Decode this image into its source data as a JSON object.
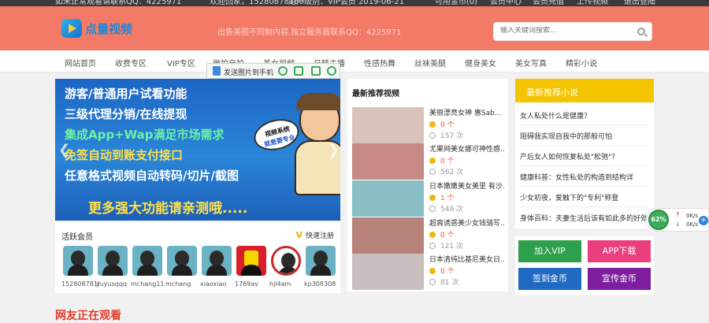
{
  "topbar": {
    "left": "如未正常观看请联系QQ：4225971",
    "welcome": "欢迎回家，15280878180",
    "level": "用户级别：VIP会员 2019-06-21",
    "coins": "可用金币(0)",
    "member_center": "会员中心",
    "member_recharge": "会员充值",
    "upload": "上传视频",
    "logout": "退出登陆"
  },
  "header": {
    "logo_text": "点量视频",
    "slogan": "出售美图不同制内容,独立服务器联系QQ：4225971",
    "search_placeholder": "输入关键词搜索..."
  },
  "nav": [
    "网站首页",
    "收费专区",
    "VIP专区",
    "微拍自拍",
    "美女视频",
    "日韩主播",
    "性感热舞",
    "丝袜美腿",
    "健身美女",
    "美女写真",
    "精彩小说"
  ],
  "float_toolbar": {
    "send_label": "发送图片到手机"
  },
  "banner": {
    "lines": [
      "游客/普通用户试看功能",
      "三级代理分销/在线提现",
      "集成App+Wap满足市场需求",
      "免签自动到账支付接口",
      "任意格式视频自动转码/切片/截图"
    ],
    "big": "更多强大功能请亲测哦.....",
    "bubble_top": "视频系统",
    "bubble_bottom": "就是要专业",
    "prev": "❮",
    "next": "❯"
  },
  "latest": {
    "title": "最新推荐视频",
    "items": [
      {
        "title": "美丽漂亮女神 惠Sab...",
        "coins": "0 个",
        "views": "157 次",
        "thumb": "#d9c2ba"
      },
      {
        "title": "尤果网美女娜可神性感...",
        "coins": "0 个",
        "views": "562 次",
        "thumb": "#c78a86"
      },
      {
        "title": "日本嫩嫩美女美里 有沙...",
        "coins": "1 个",
        "views": "548 次",
        "thumb": "#8ac0c5"
      },
      {
        "title": "超爽诱惑美少女钱骑写...",
        "coins": "0 个",
        "views": "121 次",
        "thumb": "#b7837a"
      },
      {
        "title": "日本清纯比基尼美女日...",
        "coins": "0 个",
        "views": "81 次",
        "thumb": "#c9bfbf"
      }
    ]
  },
  "recommend": {
    "title": "最新推荐小说",
    "items": [
      "女人私处什么是健康？",
      "阻碍我实现自我中的那般可怕",
      "产后女人如何恢复私处\"松弛\"？",
      "健康科普：女性私处的构造到结构详",
      "少女初夜，爱触下的\"专利\"称登",
      "身体百科：夫妻生活后该有如此多的好处"
    ]
  },
  "buttons": {
    "add_vip": "加入VIP",
    "app_download": "APP下载",
    "sign_in": "签到金币",
    "promote": "宣传金币"
  },
  "members": {
    "title": "活跃会员",
    "quick_register": "快速注册",
    "reg_mark": "V",
    "list": [
      "15280878180",
      "yuyusqqq",
      "mchang11",
      "mchang",
      "xiaoxiao",
      "1769av",
      "hjl4am",
      "kp308308"
    ]
  },
  "watching": {
    "title": "网友正在观看"
  },
  "widget": {
    "percent": "62%",
    "up": "0K/s",
    "down": "0K/s",
    "up_arrow": "↑",
    "down_arrow": "↓",
    "plus": "+"
  },
  "colors": {
    "header": "#f47a68",
    "recommend_head": "#f5c400",
    "green": "#2ea04b",
    "pink": "#ea3f7e",
    "blue": "#1f69c0",
    "purple": "#7e1e9e"
  }
}
